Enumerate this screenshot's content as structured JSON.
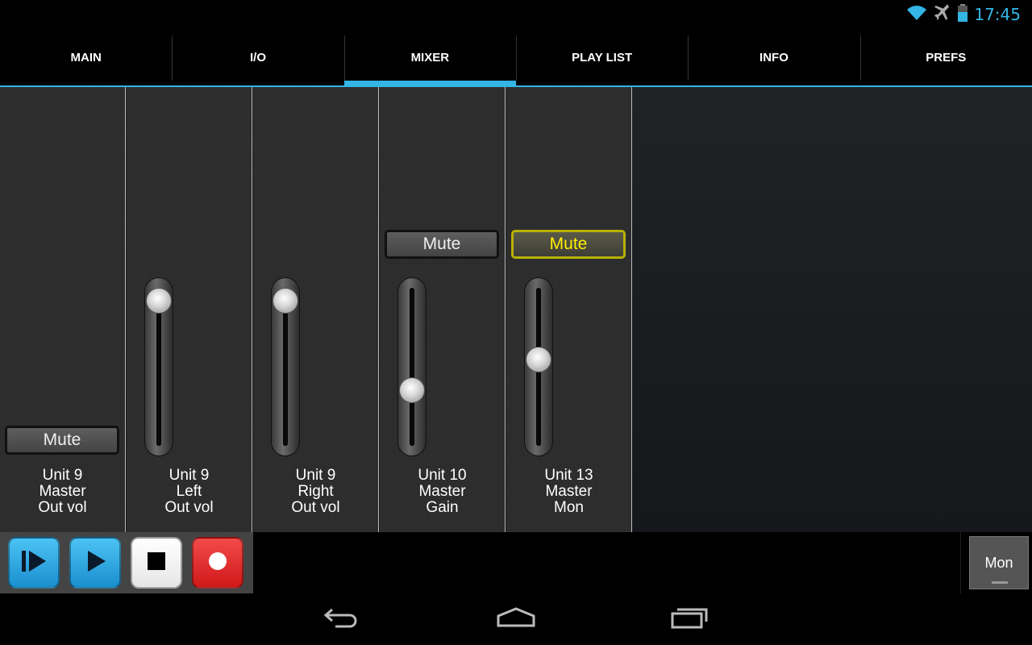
{
  "status_bar": {
    "time": "17:45",
    "icons": [
      "wifi-icon",
      "airplane-icon",
      "battery-icon"
    ],
    "accent_color": "#33b5e5"
  },
  "tabs": [
    {
      "label": "MAIN",
      "selected": false
    },
    {
      "label": "I/O",
      "selected": false
    },
    {
      "label": "MIXER",
      "selected": true
    },
    {
      "label": "PLAY LIST",
      "selected": false
    },
    {
      "label": "INFO",
      "selected": false
    },
    {
      "label": "PREFS",
      "selected": false
    }
  ],
  "channels": [
    {
      "lines": [
        "Unit 9",
        "Master",
        "Out vol"
      ],
      "mute": {
        "label": "Mute",
        "active": false
      }
    },
    {
      "lines": [
        "Unit 9",
        "Left",
        "Out vol"
      ],
      "fader_level": 0.93
    },
    {
      "lines": [
        "Unit 9",
        "Right",
        "Out vol"
      ],
      "fader_level": 0.93
    },
    {
      "lines": [
        "Unit 10",
        "Master",
        "Gain"
      ],
      "mute": {
        "label": "Mute",
        "active": false
      },
      "fader_level": 0.35
    },
    {
      "lines": [
        "Unit 13",
        "Master",
        "Mon"
      ],
      "mute": {
        "label": "Mute",
        "active": true,
        "color": "#ffef00"
      },
      "fader_level": 0.55
    }
  ],
  "transport": {
    "buttons": [
      {
        "name": "play-from-start-button",
        "icon": "play-from-start-icon",
        "color": "#1a8fd0"
      },
      {
        "name": "play-button",
        "icon": "play-icon",
        "color": "#1a8fd0"
      },
      {
        "name": "stop-button",
        "icon": "stop-icon",
        "color": "#ffffff"
      },
      {
        "name": "record-button",
        "icon": "record-icon",
        "color": "#d01818"
      }
    ],
    "mon_label": "Mon"
  },
  "nav_bar": {
    "icons": [
      "back-icon",
      "home-icon",
      "recent-apps-icon"
    ]
  }
}
